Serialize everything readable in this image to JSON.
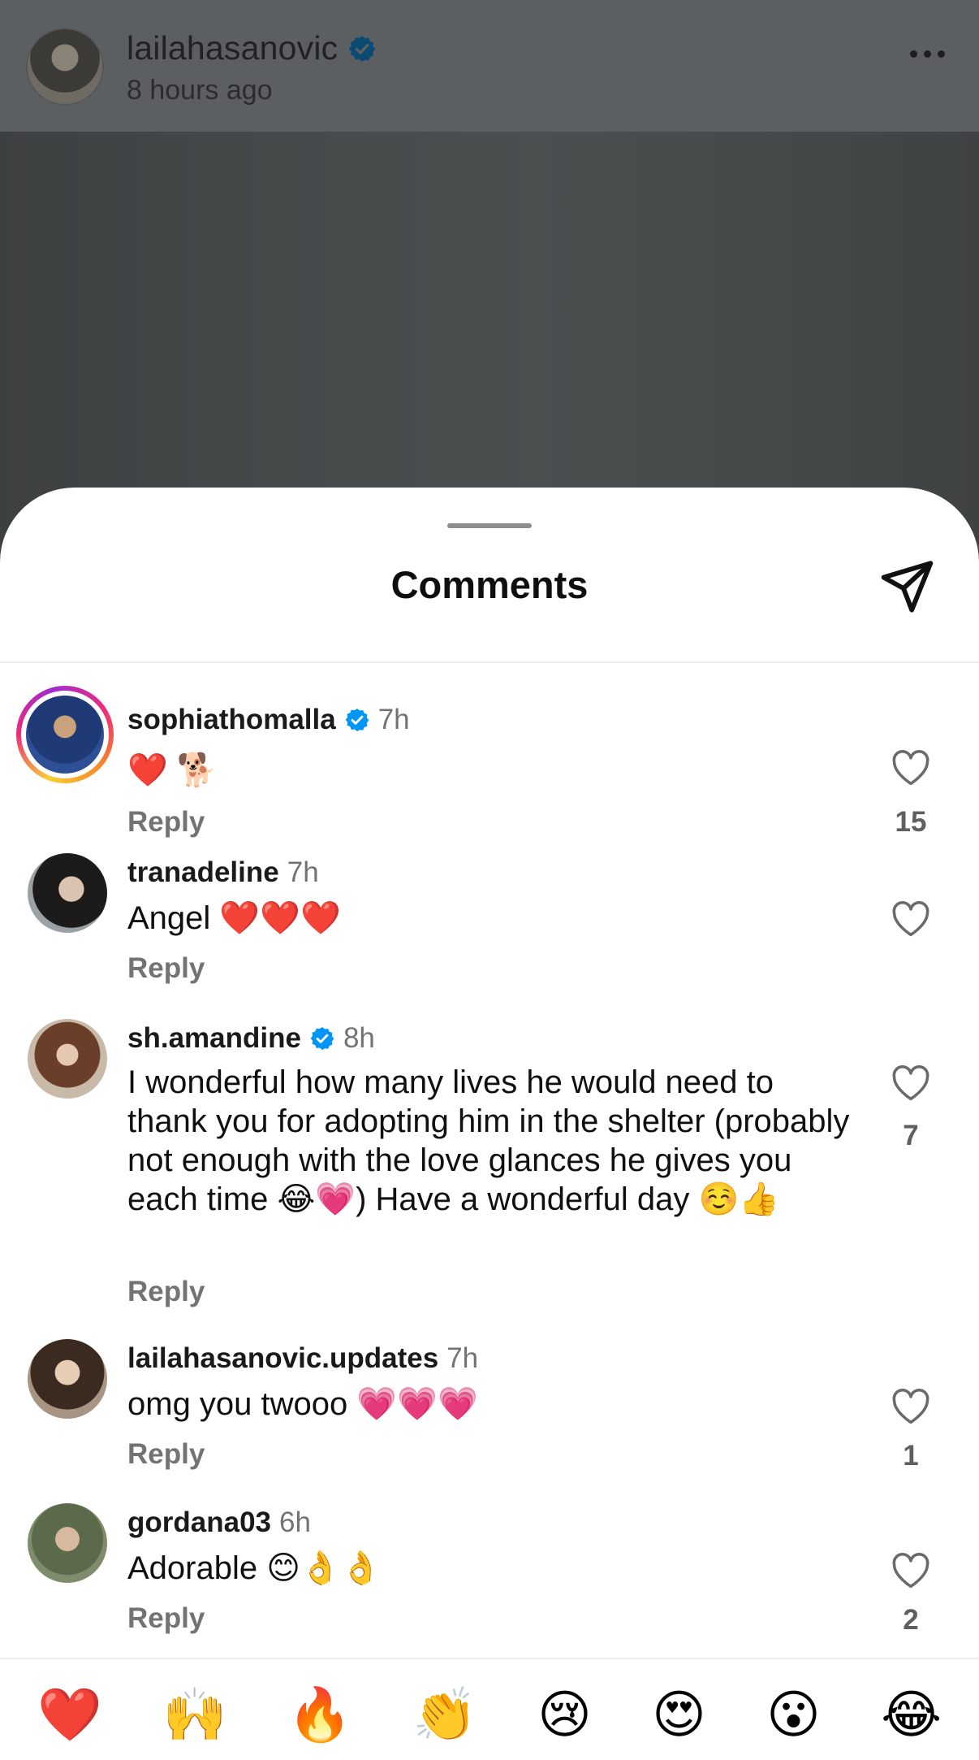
{
  "post": {
    "username": "lailahasanovic",
    "time": "8 hours ago"
  },
  "sheet": {
    "title": "Comments"
  },
  "comments": [
    {
      "username": "sophiathomalla",
      "verified": true,
      "time": "7h",
      "text": "❤️ 🐕",
      "reply": "Reply",
      "likes": "15",
      "story_ring": true
    },
    {
      "username": "tranadeline",
      "verified": false,
      "time": "7h",
      "text": "Angel ❤️❤️❤️",
      "reply": "Reply",
      "likes": ""
    },
    {
      "username": "sh.amandine",
      "verified": true,
      "time": "8h",
      "text": "I wonderful how many lives he would need to thank you for adopting him in the shelter (probably not enough with the love glances he gives you each time 😂💗) Have a wonderful day ☺️👍",
      "reply": "Reply",
      "likes": "7"
    },
    {
      "username": "lailahasanovic.updates",
      "verified": false,
      "time": "7h",
      "text": "omg you twooo 💗💗💗",
      "reply": "Reply",
      "likes": "1"
    },
    {
      "username": "gordana03",
      "verified": false,
      "time": "6h",
      "text": "Adorable 😊👌👌",
      "reply": "Reply",
      "likes": "2"
    }
  ],
  "reactions": [
    "❤️",
    "🙌",
    "🔥",
    "👏",
    "😢",
    "😍",
    "😮",
    "😂"
  ],
  "colors": {
    "verified": "#0095f6",
    "muted": "#737373",
    "sheet": "#ffffff"
  },
  "icons": [
    "more-icon",
    "verified-icon",
    "share-icon",
    "heart-icon"
  ]
}
